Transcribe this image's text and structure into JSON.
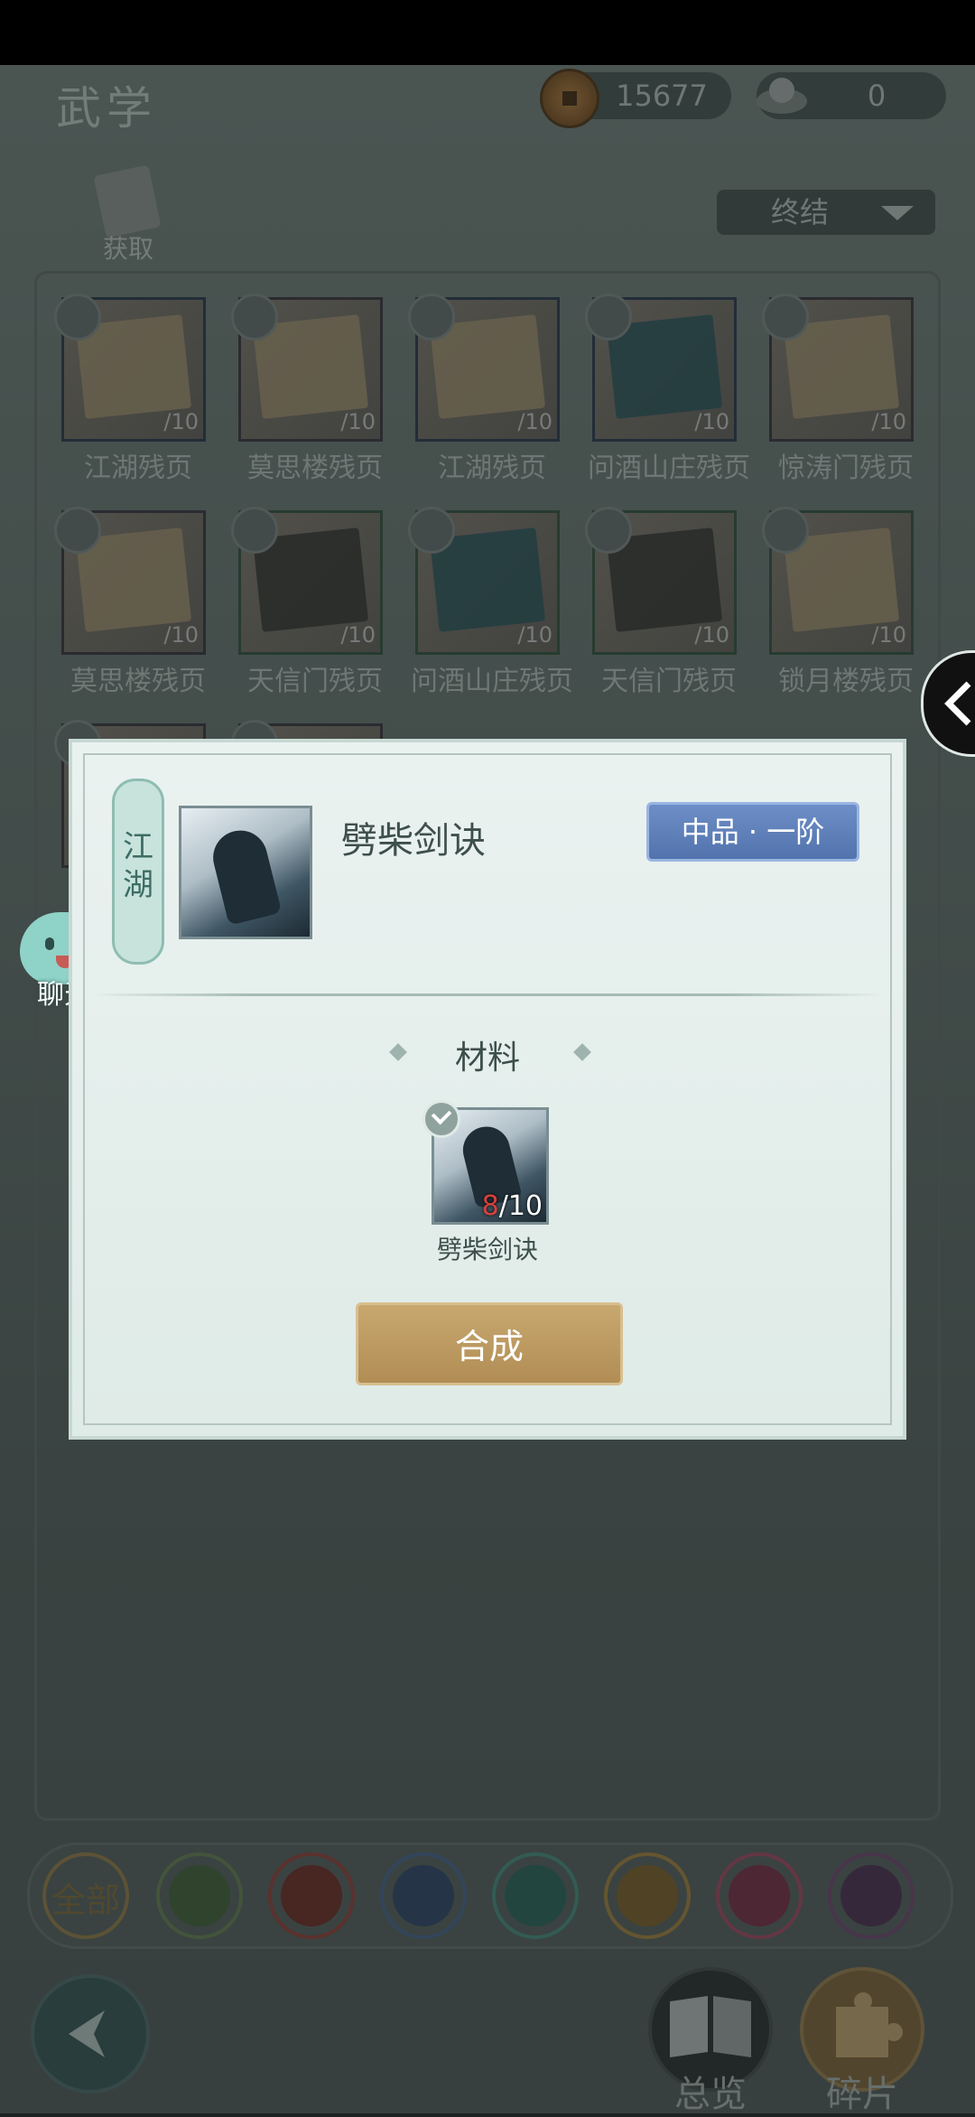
{
  "header": {
    "title": "武学",
    "coins": "15677",
    "silver": "0",
    "acquire_label": "获取",
    "filter_label": "终结"
  },
  "grid": [
    {
      "name": "江湖残页",
      "count": "/10"
    },
    {
      "name": "莫思楼残页",
      "count": "/10"
    },
    {
      "name": "江湖残页",
      "count": "/10"
    },
    {
      "name": "问酒山庄残页",
      "count": "/10"
    },
    {
      "name": "惊涛门残页",
      "count": "/10"
    },
    {
      "name": "莫思楼残页",
      "count": "/10"
    },
    {
      "name": "天信门残页",
      "count": "/10"
    },
    {
      "name": "问酒山庄残页",
      "count": "/10"
    },
    {
      "name": "天信门残页",
      "count": "/10"
    },
    {
      "name": "锁月楼残页",
      "count": "/10"
    }
  ],
  "chat_label": "聊天",
  "tabs": {
    "all_label": "全部"
  },
  "bottom": {
    "overview_label": "总览",
    "fragments_label": "碎片"
  },
  "dialog": {
    "tag": "江湖",
    "skill_name": "劈柴剑诀",
    "grade": "中品 · 一阶",
    "materials_title": "材料",
    "material_name": "劈柴剑诀",
    "material_have": "8",
    "material_need": "/10",
    "synth_label": "合成"
  },
  "colors": {
    "grade_bg": "#5a7bb5",
    "synth_bg": "#bd9a60",
    "count_red": "#d8413b"
  }
}
